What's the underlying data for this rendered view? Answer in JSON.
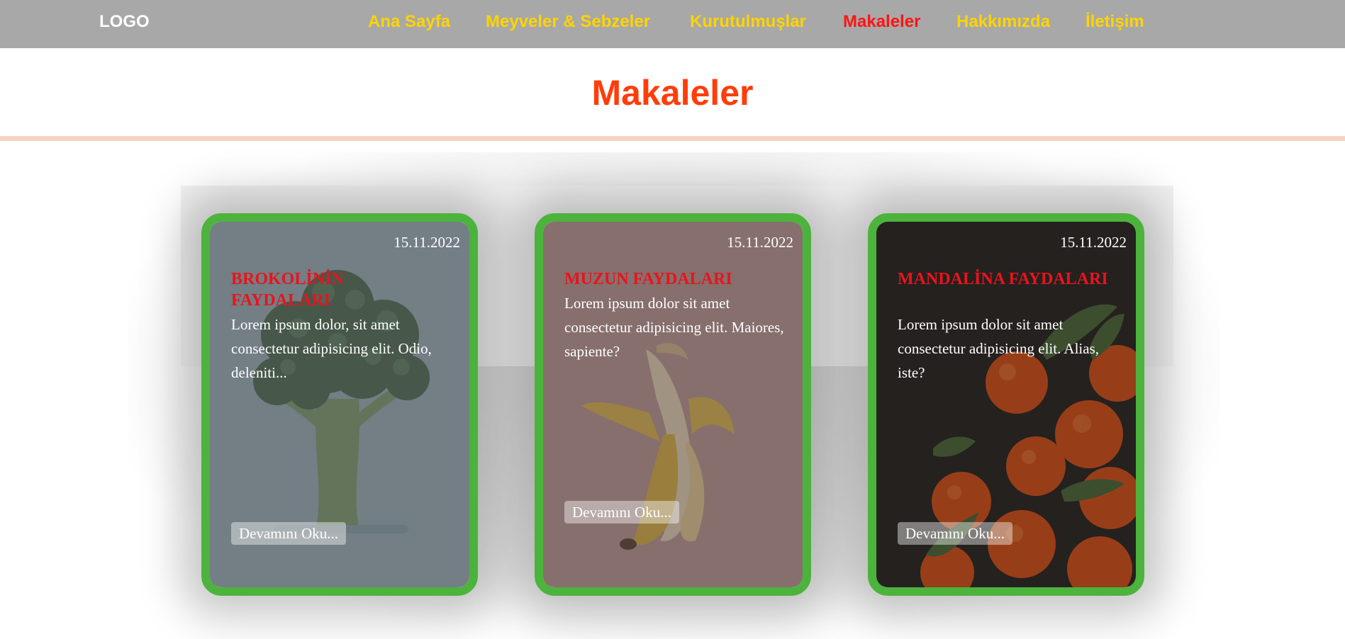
{
  "header": {
    "logo": "LOGO",
    "nav": [
      {
        "label": "Ana Sayfa",
        "active": false
      },
      {
        "label": "Meyveler & Sebzeler",
        "active": false
      },
      {
        "label": "Kurutulmuşlar",
        "active": false
      },
      {
        "label": "Makaleler",
        "active": true
      },
      {
        "label": "Hakkımızda",
        "active": false
      },
      {
        "label": "İletişim",
        "active": false
      }
    ]
  },
  "page": {
    "title": "Makaleler"
  },
  "articles": [
    {
      "date": "15.11.2022",
      "title": "BROKOLİNİN FAYDALARI",
      "text": "Lorem ipsum dolor, sit amet consectetur adipisicing elit. Odio, deleniti...",
      "button": "Devamını Oku...",
      "image": "broccoli"
    },
    {
      "date": "15.11.2022",
      "title": "MUZUN FAYDALARI",
      "text": "Lorem ipsum dolor sit amet consectetur adipisicing elit. Maiores, sapiente?",
      "button": "Devamını Oku...",
      "image": "banana"
    },
    {
      "date": "15.11.2022",
      "title": "MANDALİNA FAYDALARI",
      "text": "Lorem ipsum dolor sit amet consectetur adipisicing elit. Alias, iste?",
      "button": "Devamını Oku...",
      "image": "tangerines"
    }
  ],
  "colors": {
    "nav_bar": "#a8a8a8",
    "nav_link": "#ffd400",
    "nav_active": "#ff1414",
    "title": "#ff3d0a",
    "card_border": "#4cb33c",
    "card_title": "#e8141c"
  }
}
